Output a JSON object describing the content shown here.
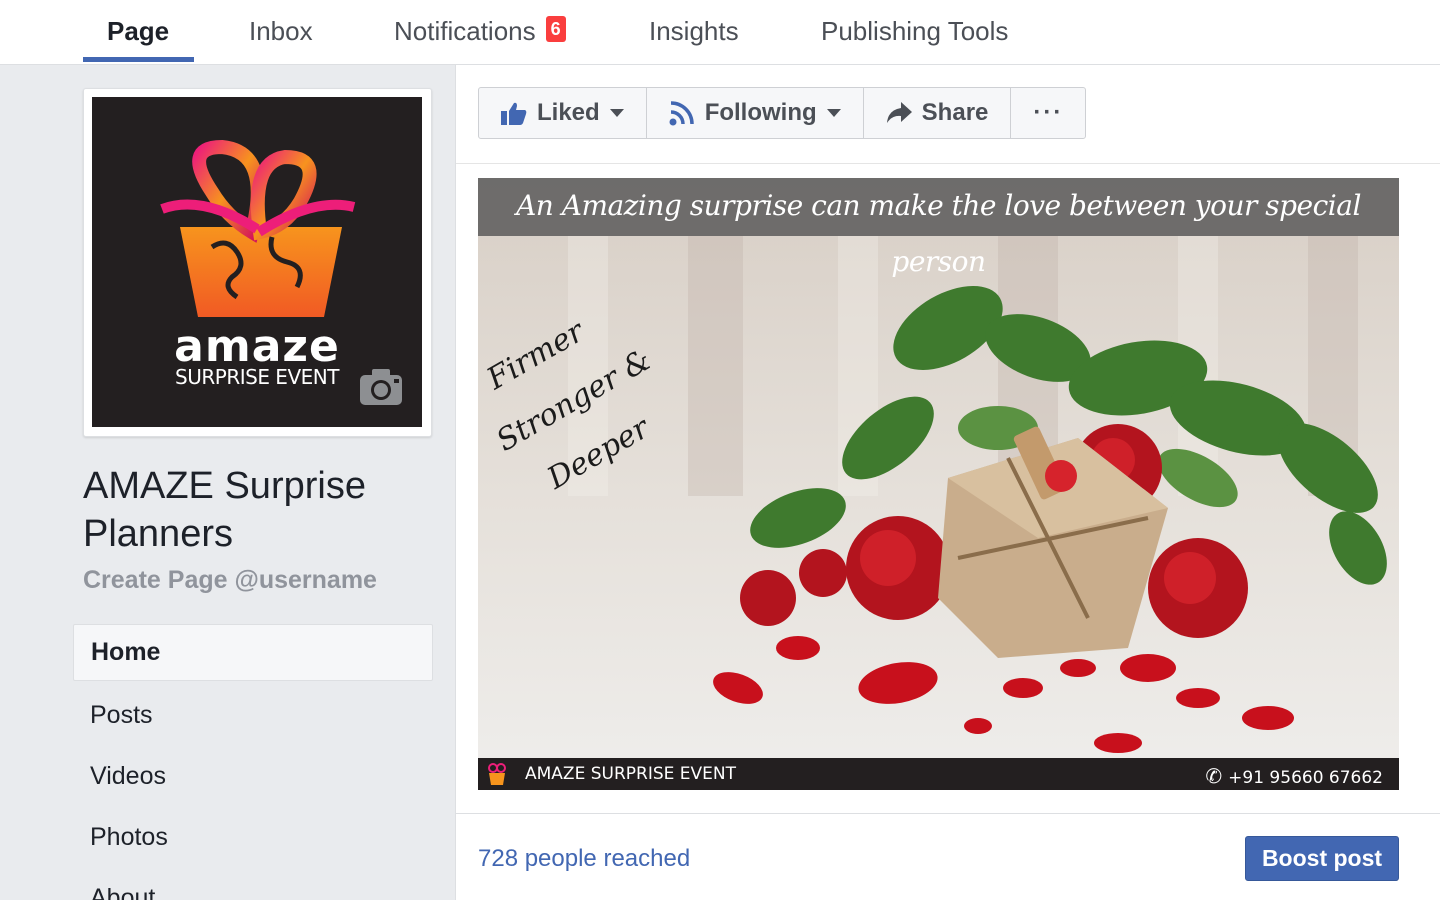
{
  "tabs": [
    {
      "label": "Page",
      "active": true
    },
    {
      "label": "Inbox"
    },
    {
      "label": "Notifications",
      "badge": "6"
    },
    {
      "label": "Insights"
    },
    {
      "label": "Publishing Tools"
    }
  ],
  "profile": {
    "logo_text": "amaze",
    "logo_subtext": "SURPRISE EVENT",
    "camera_icon": "camera-icon"
  },
  "page_name": "AMAZE Surprise Planners",
  "create_username": "Create Page @username",
  "nav": [
    {
      "label": "Home",
      "active": true
    },
    {
      "label": "Posts"
    },
    {
      "label": "Videos"
    },
    {
      "label": "Photos"
    },
    {
      "label": "About"
    }
  ],
  "actions": {
    "liked": "Liked",
    "following": "Following",
    "share": "Share",
    "more": "···"
  },
  "post": {
    "caption": "An Amazing surprise can make the love between your special person",
    "script_1": "Firmer",
    "script_2": "Stronger &",
    "script_3": "Deeper",
    "footer_name": "AMAZE SURPRISE EVENT",
    "footer_phone": "+91 95660 67662",
    "reach": "728 people reached",
    "boost": "Boost post"
  },
  "colors": {
    "accent": "#4267b2",
    "badge": "#fa3e3e",
    "background": "#e9ebee"
  }
}
